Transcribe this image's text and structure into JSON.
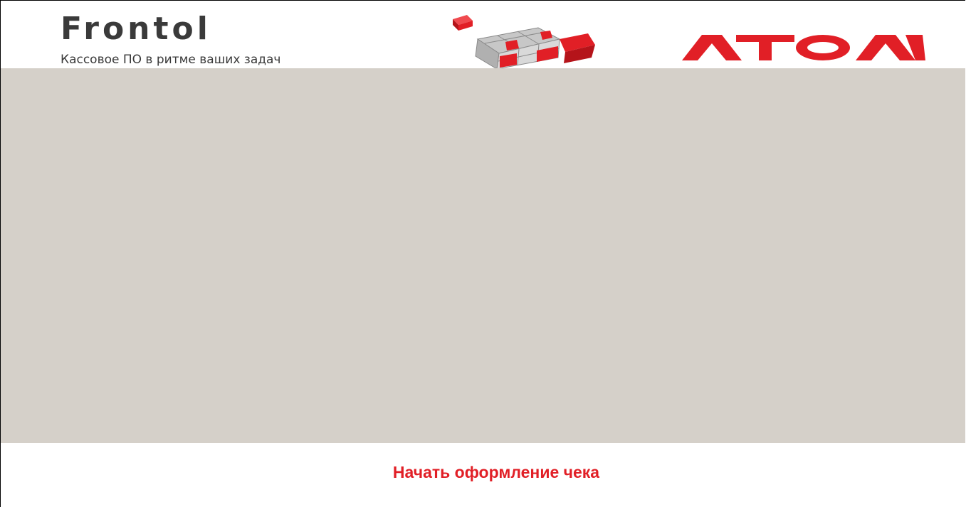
{
  "header": {
    "brand_name": "Frontol",
    "tagline": "Кассовое ПО в ритме ваших задач",
    "cube_graphic": "rubiks-cube-logo",
    "company_logo": "АТОЛ",
    "company_logo_icon": "atol-logo"
  },
  "colors": {
    "accent_red": "#e11f26",
    "brand_gray": "#3a3a3a",
    "content_background": "#d5d0c9",
    "page_background": "#ffffff"
  },
  "footer": {
    "start_receipt_label": "Начать оформление чека"
  }
}
